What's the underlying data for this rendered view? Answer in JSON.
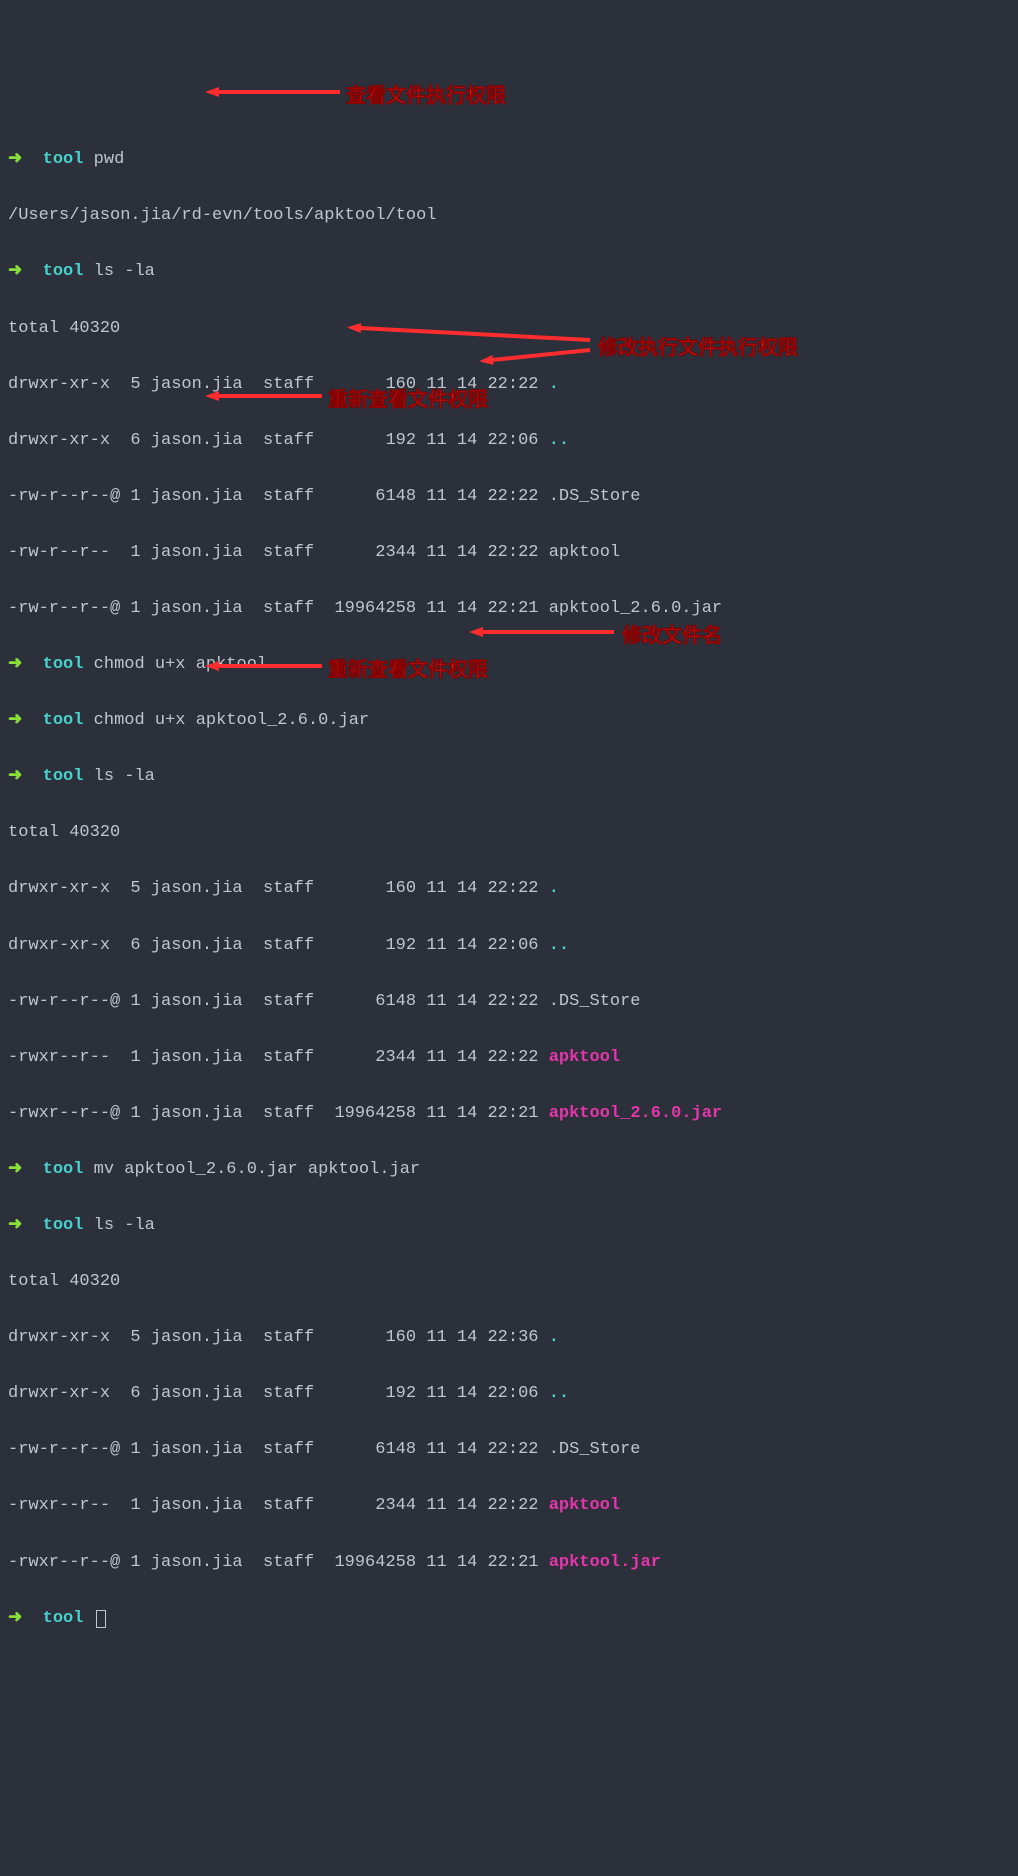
{
  "prompt": {
    "arrow": "➜",
    "tool": "tool"
  },
  "lines": {
    "l0_cmd": "pwd",
    "l1": "/Users/jason.jia/rd-evn/tools/apktool/tool",
    "l2_cmd": "ls -la",
    "l3": "total 40320",
    "l4a": "drwxr-xr-x  5 jason.jia  staff       160 11 14 22:22 ",
    "l4b": ".",
    "l5a": "drwxr-xr-x  6 jason.jia  staff       192 11 14 22:06 ",
    "l5b": "..",
    "l6": "-rw-r--r--@ 1 jason.jia  staff      6148 11 14 22:22 .DS_Store",
    "l7": "-rw-r--r--  1 jason.jia  staff      2344 11 14 22:22 apktool",
    "l8": "-rw-r--r--@ 1 jason.jia  staff  19964258 11 14 22:21 apktool_2.6.0.jar",
    "l9_cmd": "chmod u+x apktool",
    "l10_cmd": "chmod u+x apktool_2.6.0.jar",
    "l11_cmd": "ls -la",
    "l12": "total 40320",
    "l13a": "drwxr-xr-x  5 jason.jia  staff       160 11 14 22:22 ",
    "l13b": ".",
    "l14a": "drwxr-xr-x  6 jason.jia  staff       192 11 14 22:06 ",
    "l14b": "..",
    "l15": "-rw-r--r--@ 1 jason.jia  staff      6148 11 14 22:22 .DS_Store",
    "l16a": "-rwxr--r--  1 jason.jia  staff      2344 11 14 22:22 ",
    "l16b": "apktool",
    "l17a": "-rwxr--r--@ 1 jason.jia  staff  19964258 11 14 22:21 ",
    "l17b": "apktool_2.6.0.jar",
    "l18_cmd": "mv apktool_2.6.0.jar apktool.jar",
    "l19_cmd": "ls -la",
    "l20": "total 40320",
    "l21a": "drwxr-xr-x  5 jason.jia  staff       160 11 14 22:36 ",
    "l21b": ".",
    "l22a": "drwxr-xr-x  6 jason.jia  staff       192 11 14 22:06 ",
    "l22b": "..",
    "l23": "-rw-r--r--@ 1 jason.jia  staff      6148 11 14 22:22 .DS_Store",
    "l24a": "-rwxr--r--  1 jason.jia  staff      2344 11 14 22:22 ",
    "l24b": "apktool",
    "l25a": "-rwxr--r--@ 1 jason.jia  staff  19964258 11 14 22:21 ",
    "l25b": "apktool.jar"
  },
  "annotations": {
    "a1": "查看文件执行权限",
    "a2": "修改执行文件执行权限",
    "a3": "重新查看文件权限",
    "a4": "修改文件名",
    "a5": "重新查看文件权限"
  }
}
